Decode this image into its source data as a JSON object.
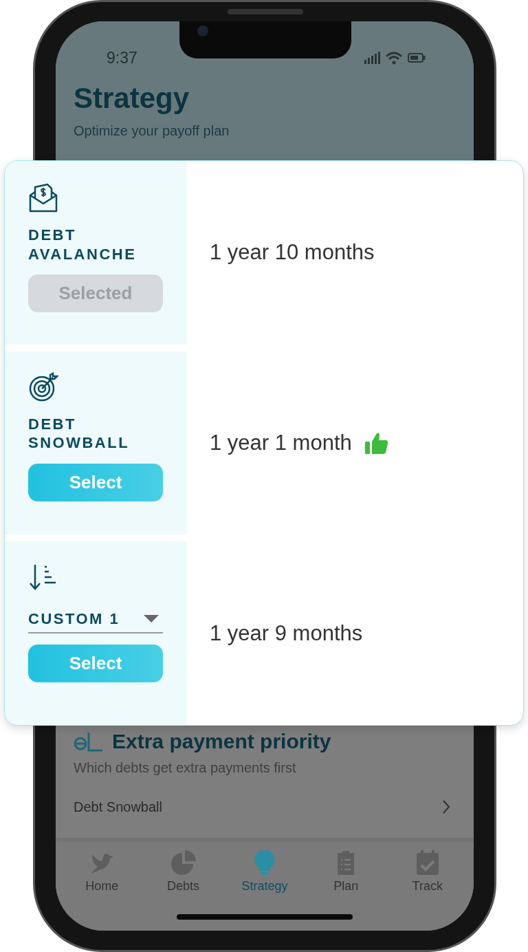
{
  "status_bar": {
    "time": "9:37"
  },
  "header": {
    "title": "Strategy",
    "subtitle": "Optimize your payoff plan"
  },
  "strategies": [
    {
      "kind": "avalanche",
      "name": "DEBT AVALANCHE",
      "button": "Selected",
      "selected": true,
      "duration": "1 year 10 months",
      "recommended": false
    },
    {
      "kind": "snowball",
      "name": "DEBT SNOWBALL",
      "button": "Select",
      "selected": false,
      "duration": "1 year 1 month",
      "recommended": true
    },
    {
      "kind": "custom",
      "name": "CUSTOM 1",
      "button": "Select",
      "selected": false,
      "duration": "1 year 9 months",
      "recommended": false
    }
  ],
  "priority": {
    "title": "Extra payment priority",
    "subtitle": "Which debts get extra payments first",
    "value": "Debt Snowball"
  },
  "tabs": [
    {
      "kind": "home",
      "label": "Home",
      "selected": false
    },
    {
      "kind": "debts",
      "label": "Debts",
      "selected": false
    },
    {
      "kind": "strategy",
      "label": "Strategy",
      "selected": true
    },
    {
      "kind": "plan",
      "label": "Plan",
      "selected": false
    },
    {
      "kind": "track",
      "label": "Track",
      "selected": false
    }
  ]
}
